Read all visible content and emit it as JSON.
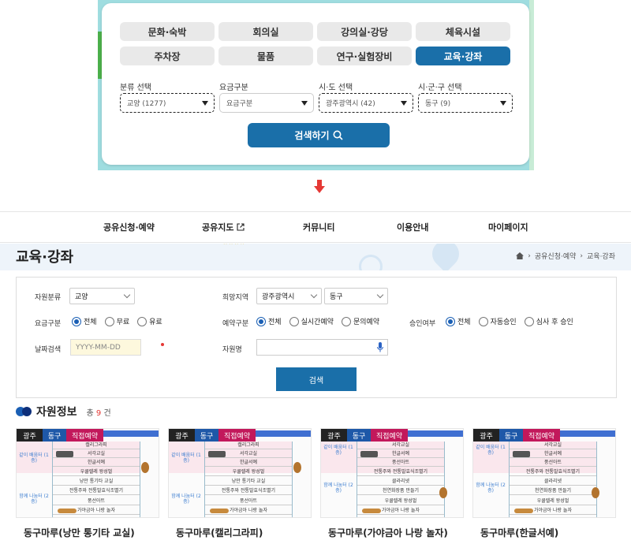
{
  "top_panel": {
    "categories": [
      {
        "label": "문화·숙박",
        "active": false
      },
      {
        "label": "회의실",
        "active": false
      },
      {
        "label": "강의실·강당",
        "active": false
      },
      {
        "label": "체육시설",
        "active": false
      },
      {
        "label": "주차장",
        "active": false
      },
      {
        "label": "물품",
        "active": false
      },
      {
        "label": "연구·실험장비",
        "active": false
      },
      {
        "label": "교육·강좌",
        "active": true
      }
    ],
    "filters": [
      {
        "label": "분류 선택",
        "value": "교양 (1277)",
        "highlighted": true
      },
      {
        "label": "요금구분",
        "value": "요금구분",
        "highlighted": false
      },
      {
        "label": "시·도 선택",
        "value": "광주광역시 (42)",
        "highlighted": true
      },
      {
        "label": "시·군·구 선택",
        "value": "동구 (9)",
        "highlighted": true
      }
    ],
    "search_label": "검색하기",
    "accent_color": "#1a6fa9",
    "arrow_color": "#e53935"
  },
  "nav": {
    "items": [
      {
        "label": "공유신청·예약"
      },
      {
        "label": "공유지도",
        "icon": "external-link-icon"
      },
      {
        "label": "커뮤니티"
      },
      {
        "label": "이용안내"
      },
      {
        "label": "마이페이지"
      }
    ]
  },
  "page": {
    "title": "교육·강좌",
    "breadcrumb": [
      "공유신청·예약",
      "교육·강좌"
    ],
    "home_icon": "home-icon"
  },
  "form": {
    "resource_type": {
      "label": "자원분류",
      "value": "교양"
    },
    "region": {
      "label": "희망지역",
      "sido": "광주광역시",
      "sigungu": "동구"
    },
    "fee": {
      "label": "요금구분",
      "options": [
        "전체",
        "무료",
        "유료"
      ],
      "selected": 0
    },
    "reservation": {
      "label": "예약구분",
      "options": [
        "전체",
        "실시간예약",
        "문의예약"
      ],
      "selected": 0
    },
    "approval": {
      "label": "승인여부",
      "options": [
        "전체",
        "자동승인",
        "심사 후 승인"
      ],
      "selected": 0
    },
    "date": {
      "label": "날짜검색",
      "placeholder": "YYYY-MM-DD"
    },
    "name": {
      "label": "자원명",
      "placeholder": ""
    },
    "search_label": "검색"
  },
  "results": {
    "title": "자원정보",
    "count_prefix": "총",
    "count": "9",
    "count_suffix": "건",
    "cards": [
      {
        "tags": [
          "광주",
          "동구",
          "직접예약"
        ],
        "title": "동구마루(낭만 통기타 교실)"
      },
      {
        "tags": [
          "광주",
          "동구",
          "직접예약"
        ],
        "title": "동구마루(캘리그라피)"
      },
      {
        "tags": [
          "광주",
          "동구",
          "직접예약"
        ],
        "title": "동구마루(가야금아 나랑 놀자)"
      },
      {
        "tags": [
          "광주",
          "동구",
          "직접예약"
        ],
        "title": "동구마루(한글서예)"
      }
    ],
    "thumb_rows_a": [
      "캘리그라피",
      "서각교실",
      "한글서예",
      "우쿨렐레 왕성벌",
      "낭만 통기타 교실",
      "전통주와 전통발효식조별기",
      "풍선아트",
      "가야금아 나랑 놀자"
    ],
    "thumb_rows_b": [
      "서각교실",
      "한글서예",
      "풍선아트",
      "전통주와 전통발효식조별기",
      "클라리넷",
      "천연화장품 만들기",
      "우쿨렐레 왕성벌",
      "가야금아 나랑 놀자"
    ],
    "thumb_groups": [
      "같이 배움터 (1층)",
      "함께 나눔터 (2층)"
    ]
  }
}
